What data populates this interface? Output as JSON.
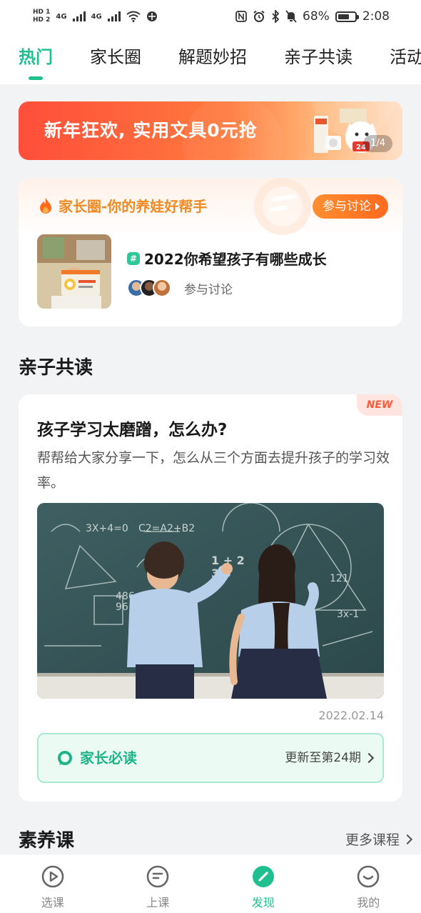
{
  "status_bar": {
    "hd1": "HD 1",
    "hd2": "HD 2",
    "net1": "4G",
    "net2": "4G",
    "battery_text": "68%",
    "battery_level": 0.68,
    "time": "2:08"
  },
  "tabs": [
    {
      "label": "热门",
      "active": true
    },
    {
      "label": "家长圈",
      "active": false
    },
    {
      "label": "解题妙招",
      "active": false
    },
    {
      "label": "亲子共读",
      "active": false
    },
    {
      "label": "活动",
      "active": false
    }
  ],
  "banner": {
    "text": "新年狂欢, 实用文具0元抢",
    "page": "1/4",
    "goods_number": "24"
  },
  "parent_circle": {
    "title": "家长圈-你的养娃好帮手",
    "join_button": "参与讨论",
    "topic": {
      "hash": "#",
      "title": "2022你希望孩子有哪些成长",
      "join_text": "参与讨论"
    }
  },
  "shared_reading": {
    "section_title": "亲子共读",
    "badge": "NEW",
    "title": "孩子学习太磨蹭，怎么办?",
    "description": "帮帮给大家分享一下，怎么从三个方面去提升孩子的学习效率。",
    "date": "2022.02.14",
    "must_read": {
      "label": "家长必读",
      "update": "更新至第24期"
    }
  },
  "literacy_course": {
    "section_title": "素养课",
    "more": "更多课程"
  },
  "bottom_nav": [
    {
      "label": "选课",
      "icon": "play-icon",
      "active": false
    },
    {
      "label": "上课",
      "icon": "lesson-icon",
      "active": false
    },
    {
      "label": "发现",
      "icon": "discover-icon",
      "active": true
    },
    {
      "label": "我的",
      "icon": "profile-icon",
      "active": false
    }
  ],
  "colors": {
    "accent": "#1fbf90",
    "orange": "#f08a24"
  }
}
